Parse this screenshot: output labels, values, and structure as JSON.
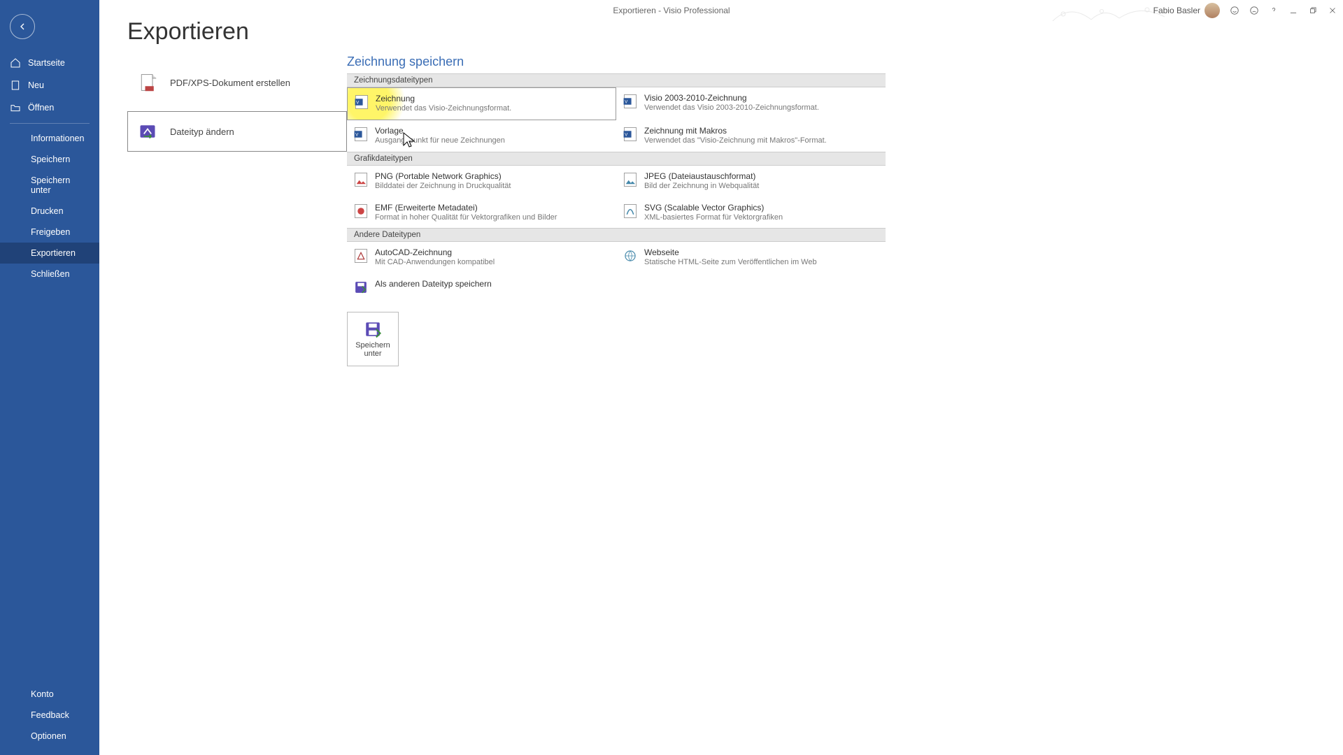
{
  "title": "Exportieren  -  Visio Professional",
  "user_name": "Fabio Basler",
  "page_heading": "Exportieren",
  "sidebar": {
    "top": [
      {
        "label": "Startseite",
        "icon": "home"
      },
      {
        "label": "Neu",
        "icon": "new"
      },
      {
        "label": "Öffnen",
        "icon": "open"
      }
    ],
    "mid": [
      {
        "label": "Informationen"
      },
      {
        "label": "Speichern"
      },
      {
        "label": "Speichern unter"
      },
      {
        "label": "Drucken"
      },
      {
        "label": "Freigeben"
      },
      {
        "label": "Exportieren",
        "selected": true
      },
      {
        "label": "Schließen"
      }
    ],
    "bottom": [
      {
        "label": "Konto"
      },
      {
        "label": "Feedback"
      },
      {
        "label": "Optionen"
      }
    ]
  },
  "export_options": {
    "pdf": "PDF/XPS-Dokument erstellen",
    "change": "Dateityp ändern"
  },
  "panel_title": "Zeichnung speichern",
  "sections": {
    "drawing": "Zeichnungsdateitypen",
    "graphic": "Grafikdateitypen",
    "other": "Andere Dateitypen"
  },
  "types": {
    "drawing": {
      "title": "Zeichnung",
      "desc": "Verwendet das Visio-Zeichnungsformat."
    },
    "visio_old": {
      "title": "Visio 2003-2010-Zeichnung",
      "desc": "Verwendet das Visio 2003-2010-Zeichnungsformat."
    },
    "template": {
      "title": "Vorlage",
      "desc": "Ausgangspunkt für neue Zeichnungen"
    },
    "macro": {
      "title": "Zeichnung mit Makros",
      "desc": "Verwendet das \"Visio-Zeichnung mit Makros\"-Format."
    },
    "png": {
      "title": "PNG (Portable Network Graphics)",
      "desc": "Bilddatei der Zeichnung in Druckqualität"
    },
    "jpeg": {
      "title": "JPEG (Dateiaustauschformat)",
      "desc": "Bild der Zeichnung in Webqualität"
    },
    "emf": {
      "title": "EMF (Erweiterte Metadatei)",
      "desc": "Format in hoher Qualität für Vektorgrafiken und Bilder"
    },
    "svg": {
      "title": "SVG (Scalable Vector Graphics)",
      "desc": "XML-basiertes Format für Vektorgrafiken"
    },
    "autocad": {
      "title": "AutoCAD-Zeichnung",
      "desc": "Mit CAD-Anwendungen kompatibel"
    },
    "web": {
      "title": "Webseite",
      "desc": "Statische HTML-Seite zum Veröffentlichen im Web"
    },
    "other": {
      "title": "Als anderen Dateityp speichern",
      "desc": ""
    }
  },
  "save_as": "Speichern unter"
}
